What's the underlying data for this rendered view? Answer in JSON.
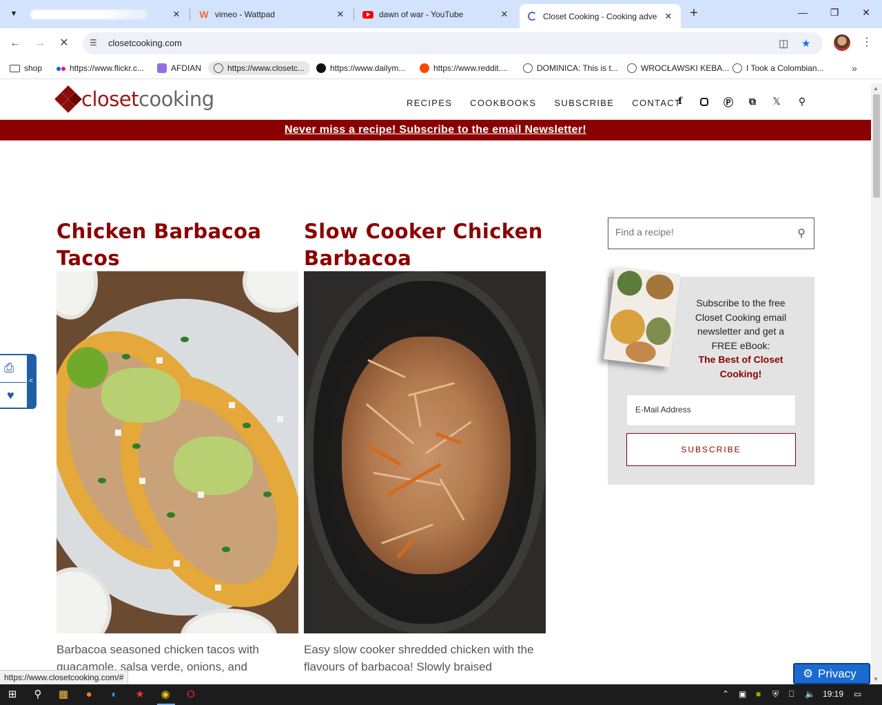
{
  "browser": {
    "tabs": [
      {
        "title": "",
        "favicon": "blurred-icon"
      },
      {
        "title": "vimeo - Wattpad",
        "favicon": "wattpad-icon"
      },
      {
        "title": "dawn of war - YouTube",
        "favicon": "youtube-icon"
      },
      {
        "title": "Closet Cooking - Cooking adve",
        "favicon": "closetcooking-icon",
        "active": true
      }
    ],
    "url": "closetcooking.com",
    "bookmarks": [
      {
        "label": "shop",
        "icon": "folder-icon"
      },
      {
        "label": "https://www.flickr.c...",
        "icon": "flickr-icon"
      },
      {
        "label": "AFDIAN",
        "icon": "afdian-icon"
      },
      {
        "label": "https://www.closetc...",
        "icon": "globe-icon"
      },
      {
        "label": "https://www.dailym...",
        "icon": "dailymotion-icon"
      },
      {
        "label": "https://www.reddit....",
        "icon": "reddit-icon"
      },
      {
        "label": "DOMINICA: This is t...",
        "icon": "globe-icon"
      },
      {
        "label": "WROCŁAWSKI KEBA...",
        "icon": "globe-icon"
      },
      {
        "label": "I Took a Colombian...",
        "icon": "globe-icon"
      }
    ],
    "status_url": "https://www.closetcooking.com/#"
  },
  "site": {
    "logo_part1": "closet",
    "logo_part2": "cooking",
    "nav": [
      "RECIPES",
      "COOKBOOKS",
      "SUBSCRIBE",
      "CONTACT"
    ],
    "social_icons": [
      "facebook-icon",
      "instagram-icon",
      "pinterest-icon",
      "rss-icon",
      "x-icon",
      "search-icon"
    ],
    "banner": "Never miss a recipe! Subscribe to the email Newsletter!"
  },
  "posts": [
    {
      "title": "Chicken Barbacoa Tacos",
      "excerpt": "Barbacoa seasoned chicken tacos with guacamole, salsa verde, onions, and"
    },
    {
      "title": "Slow Cooker Chicken Barbacoa",
      "excerpt": "Easy slow cooker shredded chicken with the flavours of barbacoa! Slowly braised"
    }
  ],
  "sidebar": {
    "search_placeholder": "Find a recipe!",
    "subscribe_text": "Subscribe to the free Closet Cooking email newsletter and get a FREE eBook:",
    "ebook_title": "The Best of Closet Cooking!",
    "email_placeholder": "E-Mail Address",
    "subscribe_button": "SUBSCRIBE"
  },
  "privacy_button": "Privacy",
  "taskbar": {
    "time": "19:19"
  },
  "colors": {
    "brand_red": "#8b0000",
    "tab_strip": "#d3e3fd"
  }
}
